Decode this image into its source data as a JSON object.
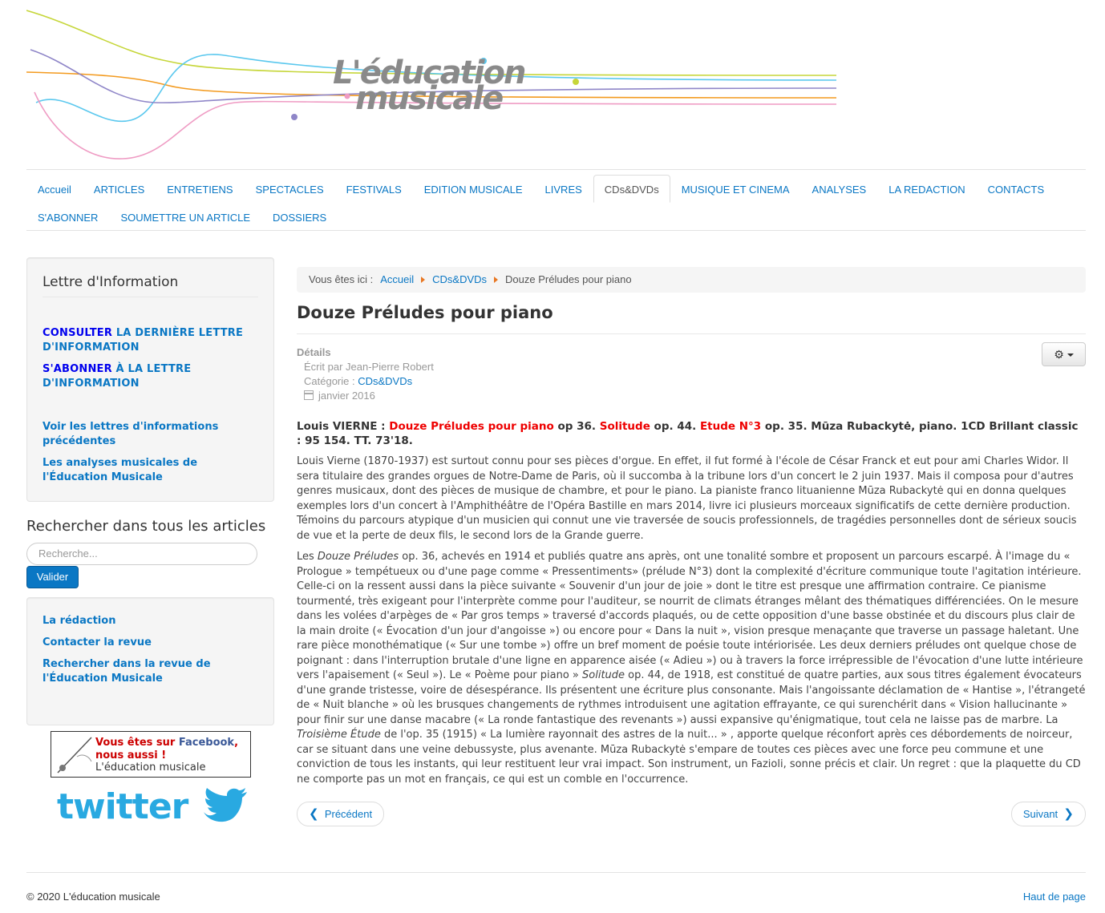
{
  "header": {
    "logo_line1": "L'éducation",
    "logo_line2": "musicale"
  },
  "nav": {
    "row1": [
      "Accueil",
      "ARTICLES",
      "ENTRETIENS",
      "SPECTACLES",
      "FESTIVALS",
      "EDITION MUSICALE",
      "LIVRES",
      "CDs&DVDs",
      "MUSIQUE ET CINEMA",
      "ANALYSES",
      "LA REDACTION",
      "CONTACTS"
    ],
    "row2": [
      "S'ABONNER",
      "SOUMETTRE UN ARTICLE",
      "DOSSIERS"
    ],
    "active": "CDs&DVDs"
  },
  "sidebar": {
    "newsletter_title": "Lettre d'Information",
    "consult_strong": "CONSULTER",
    "consult_rest": " LA DERNIÈRE LETTRE D'INFORMATION",
    "subscribe_strong": "S'ABONNER",
    "subscribe_rest": " À LA LETTRE D'INFORMATION",
    "previous_letters": "Voir les lettres d'informations précédentes",
    "analyses": "Les analyses musicales de l'Éducation Musicale",
    "search_title": "Rechercher dans tous les articles",
    "search_placeholder": "Recherche...",
    "search_button": "Valider",
    "redaction": "La rédaction",
    "contact": "Contacter la revue",
    "search_revue": "Rechercher dans la revue de l'Éducation Musicale",
    "fb_line1_a": "Vous êtes sur ",
    "fb_line1_b": "Facebook",
    "fb_line1_c": ",",
    "fb_line2": "nous aussi !",
    "fb_line3": "L'éducation musicale",
    "twitter": "twitter"
  },
  "breadcrumb": {
    "here": "Vous êtes ici :",
    "home": "Accueil",
    "category": "CDs&DVDs",
    "current": "Douze Préludes pour piano"
  },
  "article": {
    "title": "Douze Préludes pour piano",
    "details_label": "Détails",
    "author": "Écrit par Jean-Pierre Robert",
    "category_label": "Catégorie : ",
    "category": "CDs&DVDs",
    "date": "janvier 2016",
    "lead": {
      "a": "Louis VIERNE : ",
      "b": "Douze Préludes pour piano",
      "c": " op 36. ",
      "d": "Solitude",
      "e": " op. 44. ",
      "f": "Etude N°3",
      "g": " op. 35. Mūza Rubackytė, piano. 1CD Brillant classic : 95 154. TT. 73'18."
    },
    "para1": "Louis Vierne (1870-1937) est surtout connu pour ses pièces d'orgue. En effet, il fut formé à l'école de César Franck et eut pour ami Charles Widor. Il sera titulaire des grandes orgues de Notre-Dame de Paris, où il succomba à la tribune lors d'un concert le 2 juin 1937. Mais il composa pour d'autres genres musicaux, dont des pièces de musique de chambre, et pour le piano. La pianiste franco lituanienne Mūza Rubackytė qui en donna quelques exemples lors d'un concert à l'Amphithéâtre de l'Opéra Bastille en mars 2014, livre ici plusieurs morceaux significatifs de cette dernière production. Témoins du parcours atypique d'un musicien qui connut une vie traversée de soucis professionnels, de tragédies personnelles dont de sérieux soucis de vue et la perte de deux fils, le second lors de la Grande guerre.",
    "para2_a": "Les ",
    "para2_b": "Douze Préludes",
    "para2_c": " op. 36, achevés en 1914 et publiés quatre ans après, ont une tonalité sombre et proposent un parcours escarpé. À l'image du « Prologue » tempétueux ou d'une page comme « Pressentiments» (prélude N°3) dont la complexité d'écriture communique toute l'agitation intérieure. Celle-ci on la ressent aussi dans la pièce suivante « Souvenir d'un jour de joie » dont le titre est presque une affirmation contraire. Ce pianisme tourmenté, très exigeant pour l'interprète comme pour l'auditeur, se nourrit de climats étranges mêlant des thématiques différenciées. On le mesure dans les volées d'arpèges de « Par gros temps » traversé d'accords plaqués, ou de cette opposition d'une basse obstinée et du discours plus clair de la main droite (« Évocation d'un jour d'angoisse ») ou encore pour « Dans la nuit », vision presque menaçante que traverse un passage haletant. Une rare pièce monothématique (« Sur une tombe ») offre un bref moment de poésie toute intériorisée. Les deux derniers préludes ont quelque chose de poignant : dans l'interruption brutale d'une ligne en apparence aisée (« Adieu ») ou à travers la force irrépressible de l'évocation d'une lutte intérieure vers l'apaisement (« Seul »). Le « Poème pour piano » ",
    "para2_d": "Solitude",
    "para2_e": " op. 44, de 1918, est constitué de quatre parties, aux sous titres également évocateurs d'une grande tristesse, voire de désespérance. Ils présentent une écriture plus consonante. Mais l'angoissante déclamation de « Hantise », l'étrangeté de « Nuit blanche » où les brusques changements de rythmes introduisent une agitation effrayante, ce qui surenchérit dans « Vision hallucinante » pour finir sur une danse macabre (« La ronde fantastique des revenants ») aussi expansive qu'énigmatique, tout cela ne laisse pas de marbre. La ",
    "para2_f": "Troisième Étude",
    "para2_g": " de l'op. 35 (1915) « La lumière rayonnait des astres de la nuit... » , apporte quelque réconfort après ces débordements de noirceur, car se situant dans une veine debussyste, plus avenante. Mūza Rubackytė s'empare de toutes ces pièces avec une force peu commune et une conviction de tous les instants, qui leur restituent leur vrai impact. Son instrument, un Fazioli, sonne précis et clair. Un regret : que la plaquette du CD ne comporte pas un mot en français, ce qui est un comble en l'occurrence.",
    "prev": "Précédent",
    "next": "Suivant"
  },
  "footer": {
    "copyright": "© 2020 L'éducation musicale",
    "top_link": "Haut de page"
  },
  "colors": {
    "link": "#0a77c4",
    "accent_red": "#ee0000",
    "breadcrumb_arrow": "#e87722"
  }
}
